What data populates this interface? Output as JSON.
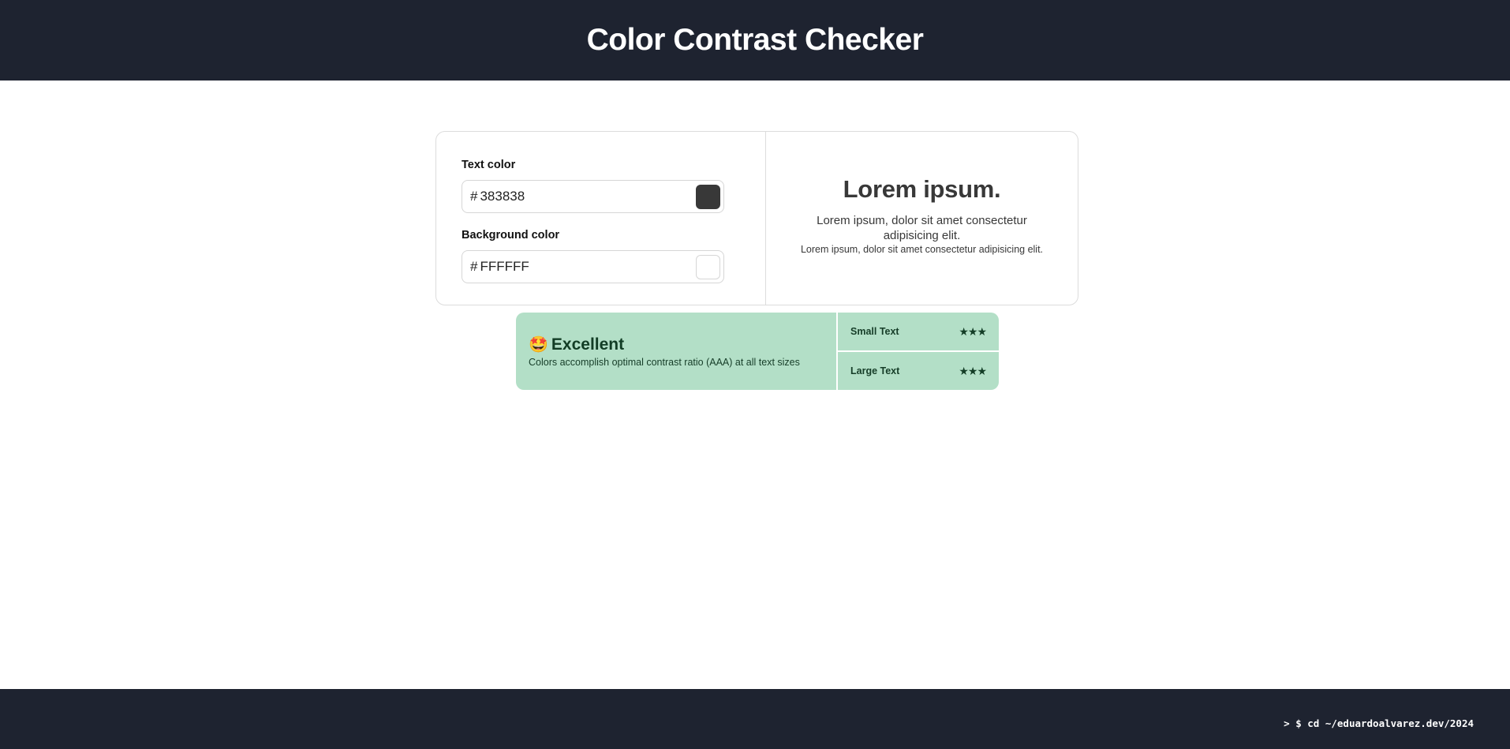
{
  "header": {
    "title": "Color Contrast Checker"
  },
  "inputs": {
    "text_color": {
      "label": "Text color",
      "prefix": "#",
      "value": "383838",
      "swatch": "#383838"
    },
    "background_color": {
      "label": "Background color",
      "prefix": "#",
      "value": "FFFFFF",
      "swatch": "#FFFFFF"
    }
  },
  "preview": {
    "title": "Lorem ipsum.",
    "body": "Lorem ipsum, dolor sit amet consectetur adipisicing elit.",
    "small": "Lorem ipsum, dolor sit amet consectetur adipisicing elit."
  },
  "result": {
    "emoji": "🤩",
    "verdict": "Excellent",
    "description": "Colors accomplish optimal contrast ratio (AAA) at all text sizes",
    "rows": [
      {
        "label": "Small Text",
        "stars": "★★★",
        "rating": 3
      },
      {
        "label": "Large Text",
        "stars": "★★★",
        "rating": 3
      }
    ],
    "accent": "#B3DFC7"
  },
  "footer": {
    "text": "> $ cd ~/eduardoalvarez.dev/2024"
  }
}
